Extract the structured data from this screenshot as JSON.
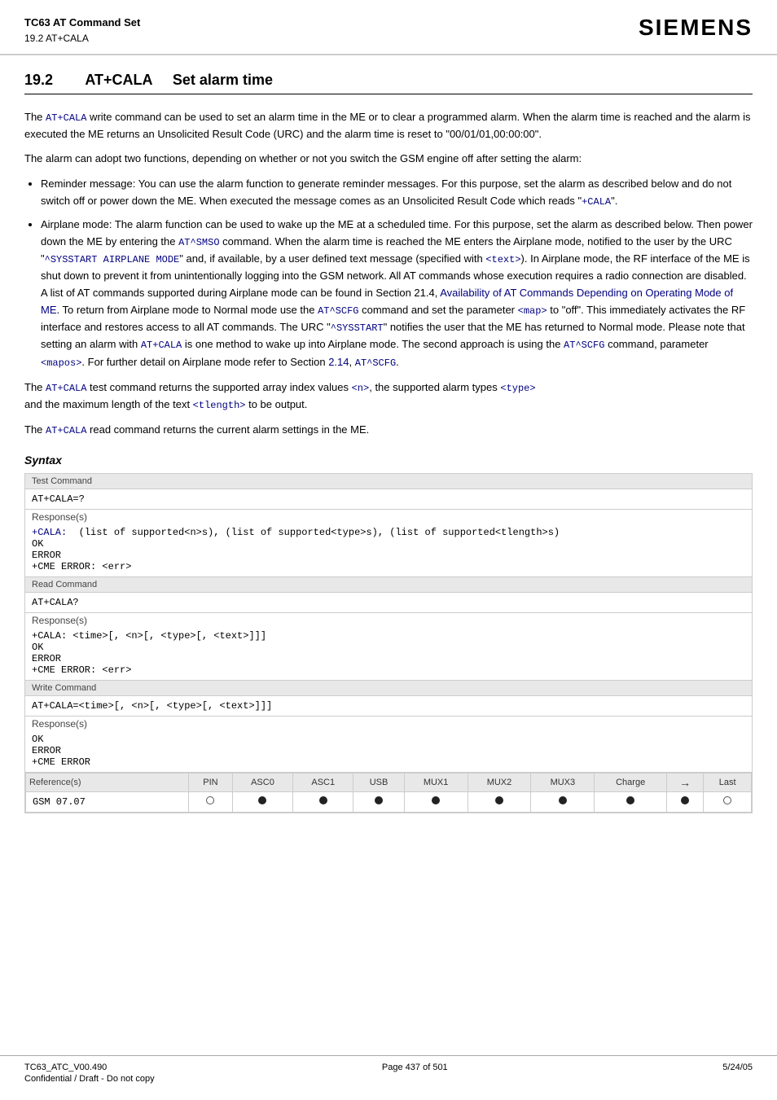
{
  "header": {
    "line1": "TC63 AT Command Set",
    "line2": "19.2 AT+CALA",
    "logo": "SIEMENS"
  },
  "section": {
    "number": "19.2",
    "title": "AT+CALA",
    "subtitle": "Set alarm time"
  },
  "body": {
    "para1": "The AT+CALA write command can be used to set an alarm time in the ME or to clear a programmed alarm. When the alarm time is reached and the alarm is executed the ME returns an Unsolicited Result Code (URC) and the alarm time is reset to \"00/01/01,00:00:00\".",
    "para2": "The alarm can adopt two functions, depending on whether or not you switch the GSM engine off after setting the alarm:",
    "bullet1_intro": "Reminder message: You can use the alarm function to generate reminder messages. For this purpose, set the alarm as described below and do not switch off or power down the ME. When executed the message comes as an Unsolicited Result Code which reads \"+CALA\".",
    "bullet2_intro": "Airplane mode: The alarm function can be used to wake up the ME at a scheduled time. For this purpose, set the alarm as described below. Then power down the ME by entering the AT^SMSO command. When the alarm time is reached the ME enters the Airplane mode, notified to the user by the URC \"^SYSSTART AIRPLANE MODE\" and, if available, by a user defined text message (specified with <text>). In Airplane mode, the RF interface of the ME is shut down to prevent it from unintentionally logging into the GSM network. All AT commands whose execution requires a radio connection are disabled. A list of AT commands supported during Airplane mode can be found in Section 21.4, Availability of AT Commands Depending on Operating Mode of ME. To return from Airplane mode to Normal mode use the AT^SCFG command and set the parameter <map> to \"off\". This immediately activates the RF interface and restores access to all AT commands. The URC \"^SYSSTART\" notifies the user that the ME has returned to Normal mode. Please note that setting an alarm with AT+CALA is one method to wake up into Airplane mode. The second approach is using the AT^SCFG command, parameter <mapos>. For further detail on Airplane mode refer to Section 2.14, AT^SCFG.",
    "para3_part1": "The AT+CALA test command returns the supported array index values <n>, the supported alarm types <type>",
    "para3_part2": "and the maximum length of the text <tlength> to be output.",
    "para4": "The AT+CALA read command returns the current alarm settings in the ME."
  },
  "syntax": {
    "heading": "Syntax",
    "test_command": {
      "label": "Test Command",
      "cmd": "AT+CALA=?",
      "response_label": "Response(s)",
      "response": "+CALA: (list of supported<n>s), (list of supported<type>s), (list of supported<tlength>s)\nOK\nERROR\n+CME ERROR: <err>"
    },
    "read_command": {
      "label": "Read Command",
      "cmd": "AT+CALA?",
      "response_label": "Response(s)",
      "response": "+CALA: <time>[, <n>[, <type>[, <text>]]]\nOK\nERROR\n+CME ERROR: <err>"
    },
    "write_command": {
      "label": "Write Command",
      "cmd": "AT+CALA=<time>[, <n>[, <type>[, <text>]]]",
      "response_label": "Response(s)",
      "response": "OK\nERROR\n+CME ERROR"
    }
  },
  "reference": {
    "label": "Reference(s)",
    "value": "GSM 07.07",
    "columns": [
      "PIN",
      "ASC0",
      "ASC1",
      "USB",
      "MUX1",
      "MUX2",
      "MUX3",
      "Charge",
      "→",
      "Last"
    ],
    "dots": [
      "empty",
      "filled",
      "filled",
      "filled",
      "filled",
      "filled",
      "filled",
      "filled",
      "filled",
      "empty"
    ]
  },
  "footer": {
    "left": "TC63_ATC_V00.490",
    "center": "Page 437 of 501",
    "right": "5/24/05",
    "sub": "Confidential / Draft - Do not copy",
    "of_text": "of"
  }
}
